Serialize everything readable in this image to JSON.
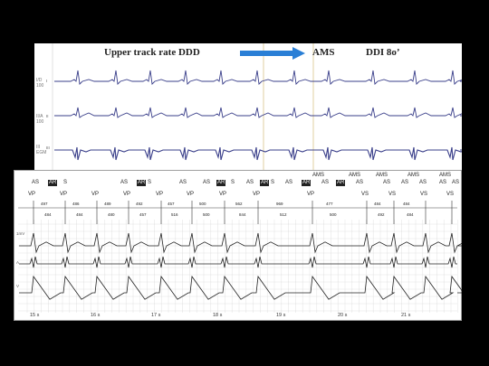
{
  "header": {
    "upper_track_label": "Upper track rate  DDD",
    "ams_label": "AMS",
    "ddi_label": "DDI 8o’"
  },
  "colors": {
    "arrow": "#2a7fd6",
    "trace": "#3a3f8a",
    "marker_line": "#d8c48a"
  },
  "top_channels": [
    {
      "label": "I",
      "side": "I/D\n100"
    },
    {
      "label": "II",
      "side": "II/A\n100"
    },
    {
      "label": "III",
      "side": "III\nEGM"
    }
  ],
  "annotations": {
    "row1": [
      "AS",
      "AR",
      "S",
      "AS",
      "AR",
      "S",
      "AS",
      "AS",
      "AR",
      "S",
      "AS",
      "AR",
      "S",
      "AS",
      "AR",
      "AS",
      "AR",
      "AS",
      "AS",
      "AS",
      "AS",
      "AS",
      "AS"
    ],
    "ams_row": [
      "AMS",
      "AMS",
      "AMS",
      "AMS",
      "AMS"
    ],
    "row2": [
      "VP",
      "VP",
      "VP",
      "VP",
      "VP",
      "VP",
      "VP",
      "VP",
      "VP",
      "VS",
      "VS",
      "VS",
      "VS"
    ],
    "intervals_top": [
      "497",
      "486",
      "489",
      "492",
      "457",
      "500",
      "562",
      "969",
      "477",
      "484",
      "484"
    ],
    "intervals_bottom": [
      "484",
      "484",
      "480",
      "457",
      "516",
      "500",
      "844",
      "512",
      "500",
      "492",
      "484"
    ]
  },
  "bottom_channels": [
    "1mV",
    "A",
    "V"
  ],
  "time_labels": [
    "15 s",
    "16 s",
    "17 s",
    "18 s",
    "19 s",
    "20 s",
    "21 s"
  ]
}
